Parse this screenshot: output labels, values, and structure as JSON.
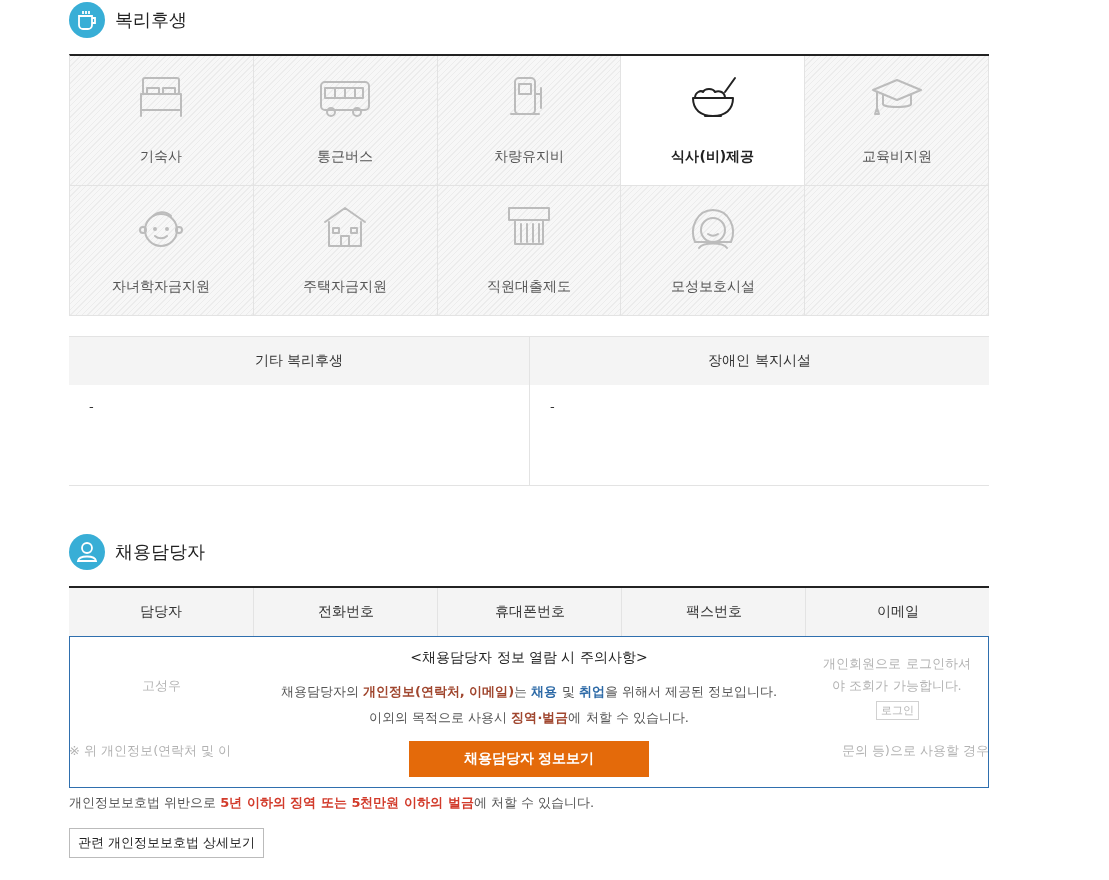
{
  "welfare": {
    "title": "복리후생",
    "items": [
      {
        "label": "기숙사",
        "selected": false
      },
      {
        "label": "통근버스",
        "selected": false
      },
      {
        "label": "차량유지비",
        "selected": false
      },
      {
        "label": "식사(비)제공",
        "selected": true
      },
      {
        "label": "교육비지원",
        "selected": false
      },
      {
        "label": "자녀학자금지원",
        "selected": false
      },
      {
        "label": "주택자금지원",
        "selected": false
      },
      {
        "label": "직원대출제도",
        "selected": false
      },
      {
        "label": "모성보호시설",
        "selected": false
      }
    ],
    "extra_table": {
      "columns": [
        "기타 복리후생",
        "장애인 복지시설"
      ],
      "cells": [
        "-",
        "-"
      ]
    }
  },
  "recruiter": {
    "title": "채용담당자",
    "columns": [
      "담당자",
      "전화번호",
      "휴대폰번호",
      "팩스번호",
      "이메일"
    ],
    "row": {
      "name": "고성우",
      "login_notice": "개인회원으로 로그인하셔야 조회가 가능합니다.",
      "login_button": "로그인"
    },
    "footnote_left": "※ 위 개인정보(연락처 및 이",
    "footnote_right": "문의 등)으로 사용할 경우",
    "notice": {
      "title": "<채용담당자 정보 열람 시 주의사항>",
      "line_1": [
        {
          "text": "채용담당자의 ",
          "kind": "plain"
        },
        {
          "text": "개인정보(연락처, 이메일)",
          "kind": "warn"
        },
        {
          "text": "는 ",
          "kind": "plain"
        },
        {
          "text": "채용",
          "kind": "info"
        },
        {
          "text": " 및 ",
          "kind": "plain"
        },
        {
          "text": "취업",
          "kind": "info"
        },
        {
          "text": "을 위해서 제공된 정보입니다.",
          "kind": "plain"
        }
      ],
      "line_2": [
        {
          "text": "이외의 목적으로 사용시 ",
          "kind": "plain"
        },
        {
          "text": "징역·벌금",
          "kind": "warn"
        },
        {
          "text": "에 처할 수 있습니다.",
          "kind": "plain"
        }
      ],
      "button": "채용담당자 정보보기"
    },
    "penalty": [
      {
        "text": "개인정보보호법 위반으로 ",
        "kind": "plain"
      },
      {
        "text": "5년 이하의 징역 또는 5천만원 이하의 벌금",
        "kind": "alert"
      },
      {
        "text": "에 처할 수 있습니다.",
        "kind": "plain"
      }
    ],
    "law_button": "관련 개인정보보호법 상세보기"
  }
}
